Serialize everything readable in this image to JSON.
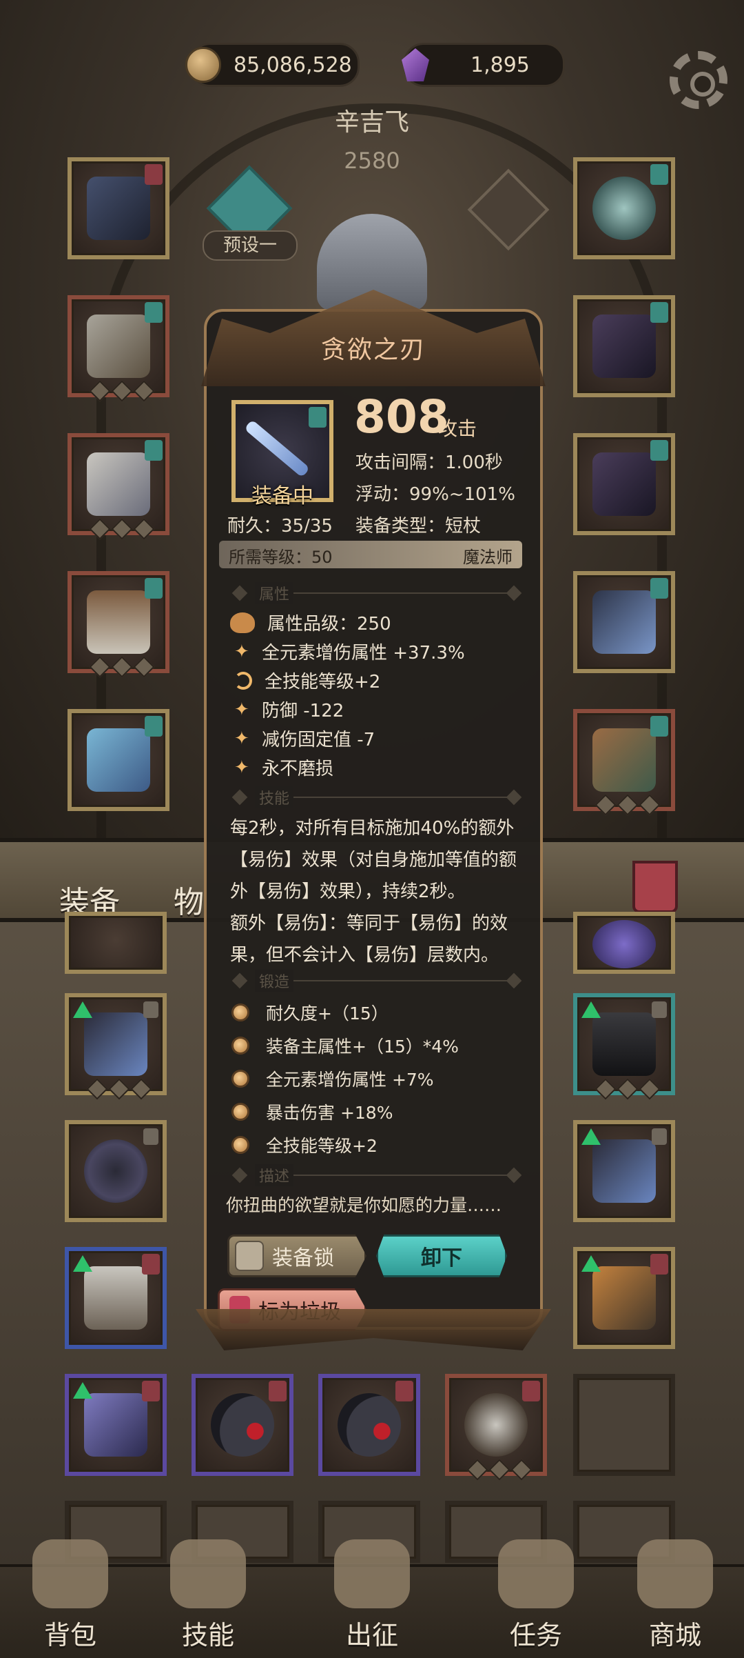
{
  "top_bar": {
    "gold": "85,086,528",
    "gems": "1,895",
    "icons": [
      "coin-icon",
      "gem-icon",
      "gear-icon"
    ]
  },
  "character": {
    "name": "辛吉飞",
    "level": "2580",
    "preset_label": "预设一"
  },
  "bag_tabs": [
    "装备",
    "物"
  ],
  "bottom_nav": [
    "背包",
    "技能",
    "出征",
    "任务",
    "商城"
  ],
  "item": {
    "name": "贪欲之刃",
    "equipped_label": "装备中",
    "attack_value": "808",
    "attack_label": "攻击",
    "attack_interval": "攻击间隔：1.00秒",
    "float_range": "浮动：99%~101%",
    "durability": "耐久：35/35",
    "equip_type": "装备类型：短杖",
    "required_level": "所需等级：50",
    "class": "魔法师",
    "sections": {
      "attributes": "属性",
      "skill": "技能",
      "forge": "锻造",
      "description": "描述"
    },
    "attributes": [
      "属性品级：250",
      "全元素增伤属性 +37.3%",
      "全技能等级+2",
      "防御 -122",
      "减伤固定值 -7",
      "永不磨损"
    ],
    "skill_text": [
      "每2秒，对所有目标施加40%的额外",
      "【易伤】效果（对自身施加等值的额",
      "外【易伤】效果），持续2秒。",
      "额外【易伤】：等同于【易伤】的效",
      "果，但不会计入【易伤】层数内。"
    ],
    "forge": [
      "耐久度+（15）",
      "装备主属性+（15）*4%",
      "全元素增伤属性 +7%",
      "暴击伤害 +18%",
      "全技能等级+2"
    ],
    "description": "你扭曲的欲望就是你如愿的力量……",
    "buttons": {
      "lock": "装备锁",
      "unequip": "卸下",
      "mark_junk": "标为垃圾"
    }
  },
  "colors": {
    "title": "#f0c7a0",
    "accent_teal": "#3d8f8a",
    "gold_frame": "#d1b06c"
  }
}
